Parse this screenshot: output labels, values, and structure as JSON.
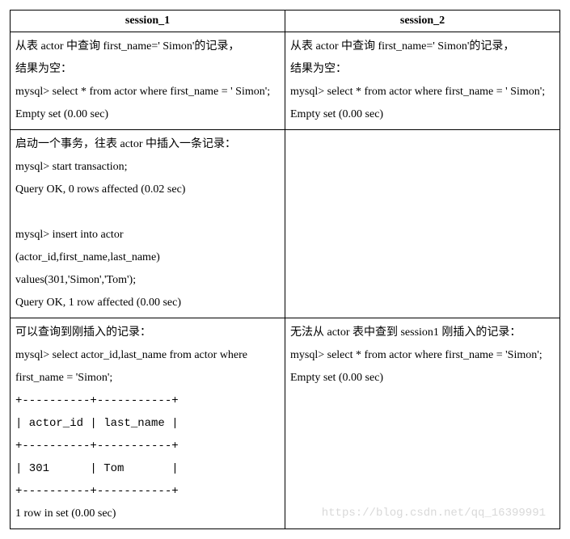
{
  "headers": {
    "col1": "session_1",
    "col2": "session_2"
  },
  "rows": [
    {
      "left": "从表 actor 中查询 first_name='Simon'的记录，\n结果为空：\nmysql> select * from actor where first_name = 'Simon';\nEmpty set (0.00 sec)",
      "right": "从表 actor 中查询 first_name='Simon'的记录，\n结果为空：\nmysql> select * from actor where first_name = 'Simon';\nEmpty set (0.00 sec)"
    },
    {
      "left": "启动一个事务，往表 actor 中插入一条记录：\nmysql> start transaction;\nQuery OK, 0 rows affected (0.02 sec)\n\nmysql> insert into actor\n(actor_id,first_name,last_name)\nvalues(301,'Simon','Tom');\nQuery OK, 1 row affected (0.00 sec)",
      "right": ""
    },
    {
      "left": "可以查询到刚插入的记录：\nmysql> select actor_id,last_name from actor where first_name = 'Simon';\n+----------+-----------+\n| actor_id | last_name |\n+----------+-----------+\n| 301      | Tom       |\n+----------+-----------+\n1 row in set (0.00 sec)",
      "right": "无法从 actor 表中查到 session1 刚插入的记录：\nmysql> select * from actor where first_name = 'Simon';\nEmpty set (0.00 sec)"
    }
  ],
  "watermark": "https://blog.csdn.net/qq_16399991"
}
